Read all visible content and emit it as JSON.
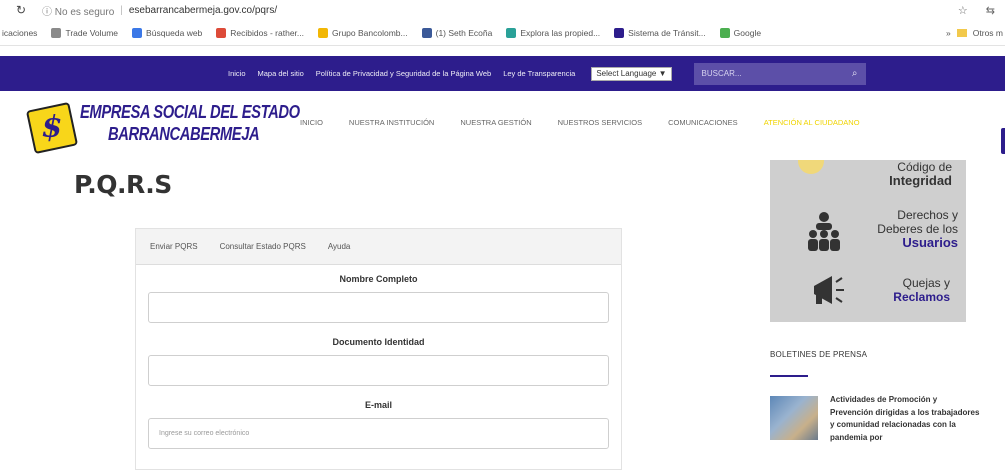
{
  "browser": {
    "security": "No es seguro",
    "url": "esebarrancabermeja.gov.co/pqrs/",
    "bookmarks": [
      {
        "label": "icaciones",
        "color": "#ffffff"
      },
      {
        "label": "Trade Volume",
        "color": "#8a8a8a"
      },
      {
        "label": "Búsqueda web",
        "color": "#3b78e7"
      },
      {
        "label": "Recibidos - rather...",
        "color": "#dd4b39"
      },
      {
        "label": "Grupo Bancolomb...",
        "color": "#f2b705"
      },
      {
        "label": "(1) Seth Ecoña",
        "color": "#3b5998"
      },
      {
        "label": "Explora las propied...",
        "color": "#2aa198"
      },
      {
        "label": "Sistema de Tránsit...",
        "color": "#2d1d8c"
      },
      {
        "label": "Google",
        "color": "#4caf50"
      }
    ],
    "more_bookmarks": "Otros m"
  },
  "topnav": {
    "links": [
      "Inicio",
      "Mapa del sitio",
      "Política de Privacidad y Seguridad de la Página Web",
      "Ley de Transparencia"
    ],
    "language": "Select Language ▼",
    "search_placeholder": "BUSCAR..."
  },
  "logo": {
    "line1": "EMPRESA SOCIAL DEL ESTADO",
    "line2": "BARRANCABERMEJA",
    "badge": "$"
  },
  "mainnav": {
    "items": [
      "INICIO",
      "NUESTRA INSTITUCIÓN",
      "NUESTRA GESTIÓN",
      "NUESTROS SERVICIOS",
      "COMUNICACIONES",
      "ATENCIÓN AL CIUDADANO"
    ],
    "active_index": 5,
    "active_color": "#f0d400"
  },
  "page": {
    "title": "P.Q.R.S"
  },
  "form": {
    "tabs": [
      "Enviar PQRS",
      "Consultar Estado PQRS",
      "Ayuda"
    ],
    "fields": [
      {
        "label": "Nombre Completo",
        "placeholder": ""
      },
      {
        "label": "Documento Identidad",
        "placeholder": ""
      },
      {
        "label": "E-mail",
        "placeholder": "Ingrese su correo electrónico"
      }
    ]
  },
  "sidebar": {
    "banner": {
      "item1_line1": "Código de",
      "item1_line2": "Integridad",
      "item2_line1": "Derechos y",
      "item2_line2": "Deberes de los",
      "item2_line3": "Usuarios",
      "item3_line1": "Quejas y",
      "item3_line2": "Reclamos"
    },
    "section_title": "BOLETINES DE PRENSA",
    "news": {
      "text": "Actividades de Promoción y Prevención dirigidas a los trabajadores y comunidad relacionadas con la pandemia por"
    }
  },
  "colors": {
    "brand_purple": "#2d1d8c",
    "brand_yellow": "#f8d61a"
  }
}
